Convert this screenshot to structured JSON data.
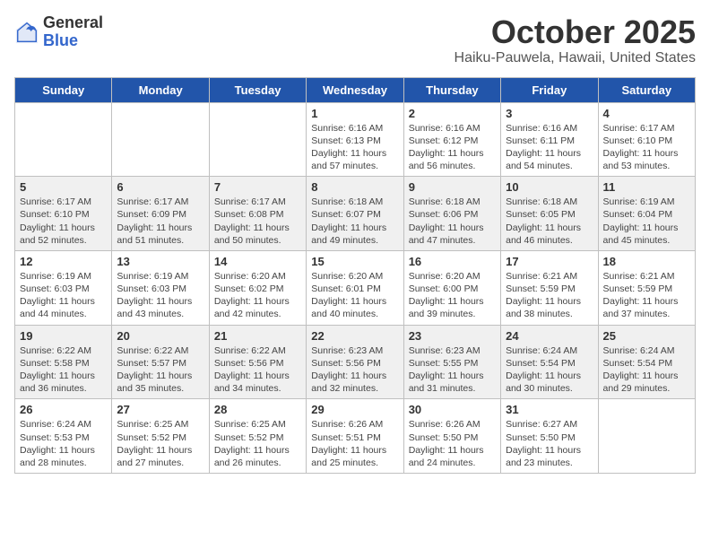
{
  "logo": {
    "general": "General",
    "blue": "Blue"
  },
  "title": "October 2025",
  "location": "Haiku-Pauwela, Hawaii, United States",
  "weekdays": [
    "Sunday",
    "Monday",
    "Tuesday",
    "Wednesday",
    "Thursday",
    "Friday",
    "Saturday"
  ],
  "weeks": [
    [
      {
        "day": "",
        "info": ""
      },
      {
        "day": "",
        "info": ""
      },
      {
        "day": "",
        "info": ""
      },
      {
        "day": "1",
        "info": "Sunrise: 6:16 AM\nSunset: 6:13 PM\nDaylight: 11 hours\nand 57 minutes."
      },
      {
        "day": "2",
        "info": "Sunrise: 6:16 AM\nSunset: 6:12 PM\nDaylight: 11 hours\nand 56 minutes."
      },
      {
        "day": "3",
        "info": "Sunrise: 6:16 AM\nSunset: 6:11 PM\nDaylight: 11 hours\nand 54 minutes."
      },
      {
        "day": "4",
        "info": "Sunrise: 6:17 AM\nSunset: 6:10 PM\nDaylight: 11 hours\nand 53 minutes."
      }
    ],
    [
      {
        "day": "5",
        "info": "Sunrise: 6:17 AM\nSunset: 6:10 PM\nDaylight: 11 hours\nand 52 minutes."
      },
      {
        "day": "6",
        "info": "Sunrise: 6:17 AM\nSunset: 6:09 PM\nDaylight: 11 hours\nand 51 minutes."
      },
      {
        "day": "7",
        "info": "Sunrise: 6:17 AM\nSunset: 6:08 PM\nDaylight: 11 hours\nand 50 minutes."
      },
      {
        "day": "8",
        "info": "Sunrise: 6:18 AM\nSunset: 6:07 PM\nDaylight: 11 hours\nand 49 minutes."
      },
      {
        "day": "9",
        "info": "Sunrise: 6:18 AM\nSunset: 6:06 PM\nDaylight: 11 hours\nand 47 minutes."
      },
      {
        "day": "10",
        "info": "Sunrise: 6:18 AM\nSunset: 6:05 PM\nDaylight: 11 hours\nand 46 minutes."
      },
      {
        "day": "11",
        "info": "Sunrise: 6:19 AM\nSunset: 6:04 PM\nDaylight: 11 hours\nand 45 minutes."
      }
    ],
    [
      {
        "day": "12",
        "info": "Sunrise: 6:19 AM\nSunset: 6:03 PM\nDaylight: 11 hours\nand 44 minutes."
      },
      {
        "day": "13",
        "info": "Sunrise: 6:19 AM\nSunset: 6:03 PM\nDaylight: 11 hours\nand 43 minutes."
      },
      {
        "day": "14",
        "info": "Sunrise: 6:20 AM\nSunset: 6:02 PM\nDaylight: 11 hours\nand 42 minutes."
      },
      {
        "day": "15",
        "info": "Sunrise: 6:20 AM\nSunset: 6:01 PM\nDaylight: 11 hours\nand 40 minutes."
      },
      {
        "day": "16",
        "info": "Sunrise: 6:20 AM\nSunset: 6:00 PM\nDaylight: 11 hours\nand 39 minutes."
      },
      {
        "day": "17",
        "info": "Sunrise: 6:21 AM\nSunset: 5:59 PM\nDaylight: 11 hours\nand 38 minutes."
      },
      {
        "day": "18",
        "info": "Sunrise: 6:21 AM\nSunset: 5:59 PM\nDaylight: 11 hours\nand 37 minutes."
      }
    ],
    [
      {
        "day": "19",
        "info": "Sunrise: 6:22 AM\nSunset: 5:58 PM\nDaylight: 11 hours\nand 36 minutes."
      },
      {
        "day": "20",
        "info": "Sunrise: 6:22 AM\nSunset: 5:57 PM\nDaylight: 11 hours\nand 35 minutes."
      },
      {
        "day": "21",
        "info": "Sunrise: 6:22 AM\nSunset: 5:56 PM\nDaylight: 11 hours\nand 34 minutes."
      },
      {
        "day": "22",
        "info": "Sunrise: 6:23 AM\nSunset: 5:56 PM\nDaylight: 11 hours\nand 32 minutes."
      },
      {
        "day": "23",
        "info": "Sunrise: 6:23 AM\nSunset: 5:55 PM\nDaylight: 11 hours\nand 31 minutes."
      },
      {
        "day": "24",
        "info": "Sunrise: 6:24 AM\nSunset: 5:54 PM\nDaylight: 11 hours\nand 30 minutes."
      },
      {
        "day": "25",
        "info": "Sunrise: 6:24 AM\nSunset: 5:54 PM\nDaylight: 11 hours\nand 29 minutes."
      }
    ],
    [
      {
        "day": "26",
        "info": "Sunrise: 6:24 AM\nSunset: 5:53 PM\nDaylight: 11 hours\nand 28 minutes."
      },
      {
        "day": "27",
        "info": "Sunrise: 6:25 AM\nSunset: 5:52 PM\nDaylight: 11 hours\nand 27 minutes."
      },
      {
        "day": "28",
        "info": "Sunrise: 6:25 AM\nSunset: 5:52 PM\nDaylight: 11 hours\nand 26 minutes."
      },
      {
        "day": "29",
        "info": "Sunrise: 6:26 AM\nSunset: 5:51 PM\nDaylight: 11 hours\nand 25 minutes."
      },
      {
        "day": "30",
        "info": "Sunrise: 6:26 AM\nSunset: 5:50 PM\nDaylight: 11 hours\nand 24 minutes."
      },
      {
        "day": "31",
        "info": "Sunrise: 6:27 AM\nSunset: 5:50 PM\nDaylight: 11 hours\nand 23 minutes."
      },
      {
        "day": "",
        "info": ""
      }
    ]
  ]
}
